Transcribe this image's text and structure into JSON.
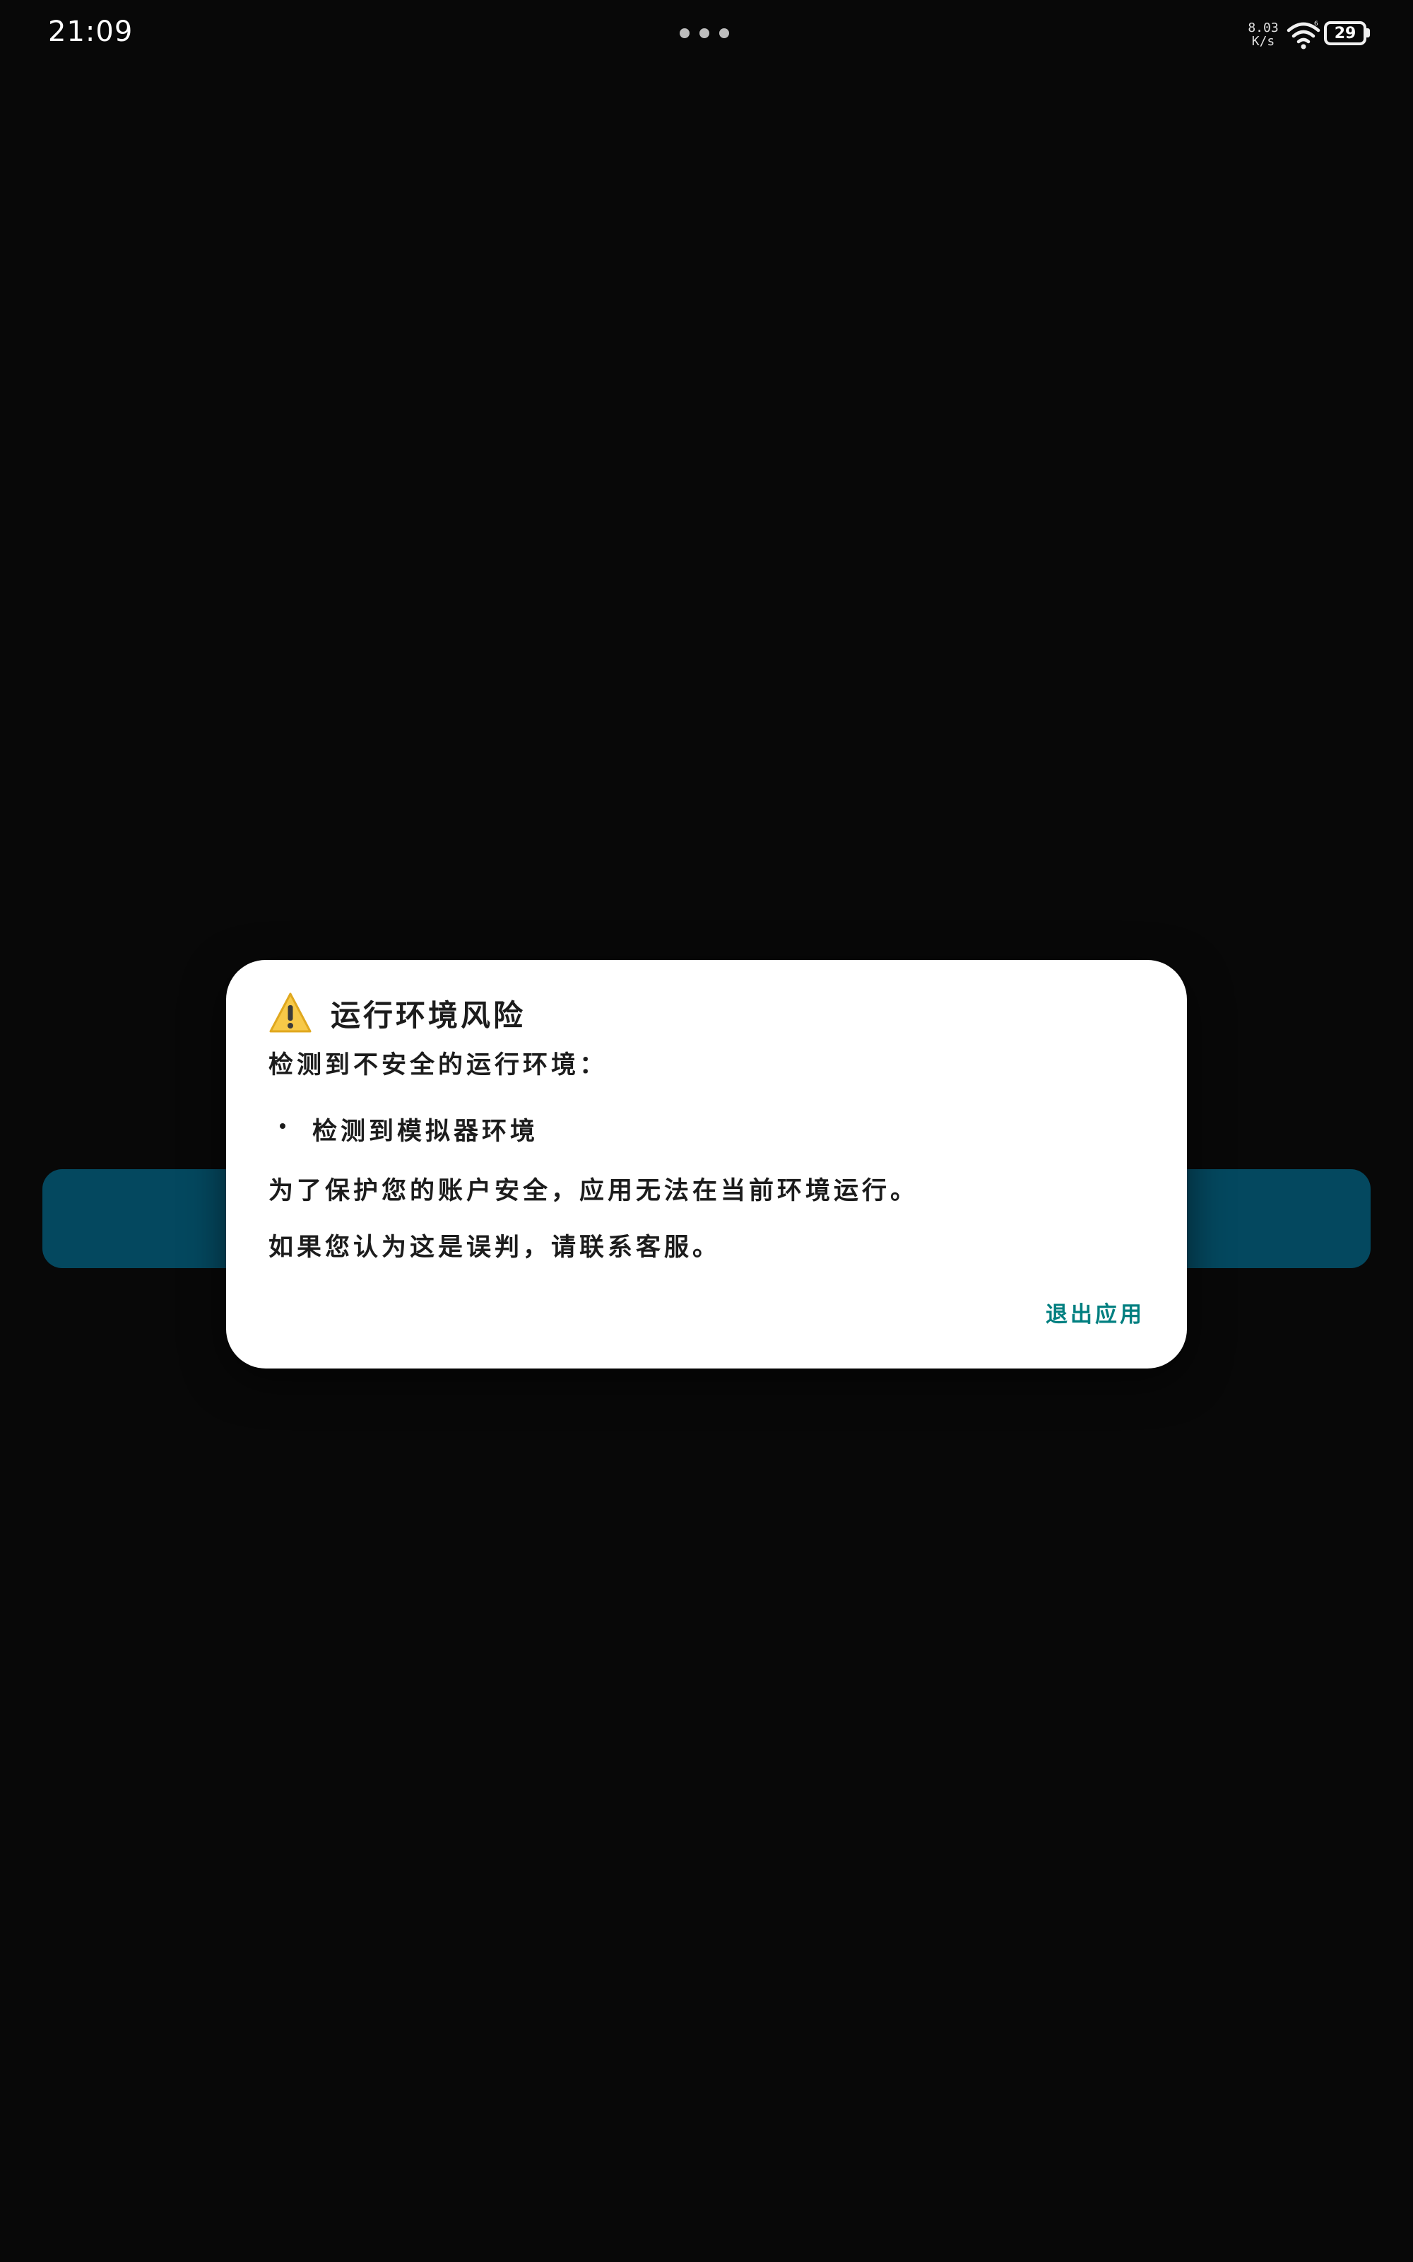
{
  "status_bar": {
    "time": "21:09",
    "net_speed_value": "8.03",
    "net_speed_unit": "K/s",
    "wifi_icon": "wifi-icon",
    "battery_level": "29"
  },
  "background": {
    "primary_button_color": "#04485f",
    "page_color": "#080808"
  },
  "dialog": {
    "icon": "warning-icon",
    "title": "运行环境风险",
    "subtitle": "检测到不安全的运行环境：",
    "bullets": [
      "检测到模拟器环境"
    ],
    "message_protect": "为了保护您的账户安全，应用无法在当前环境运行。",
    "message_contact": "如果您认为这是误判，请联系客服。",
    "exit_label": "退出应用",
    "accent_color": "#007f80"
  }
}
